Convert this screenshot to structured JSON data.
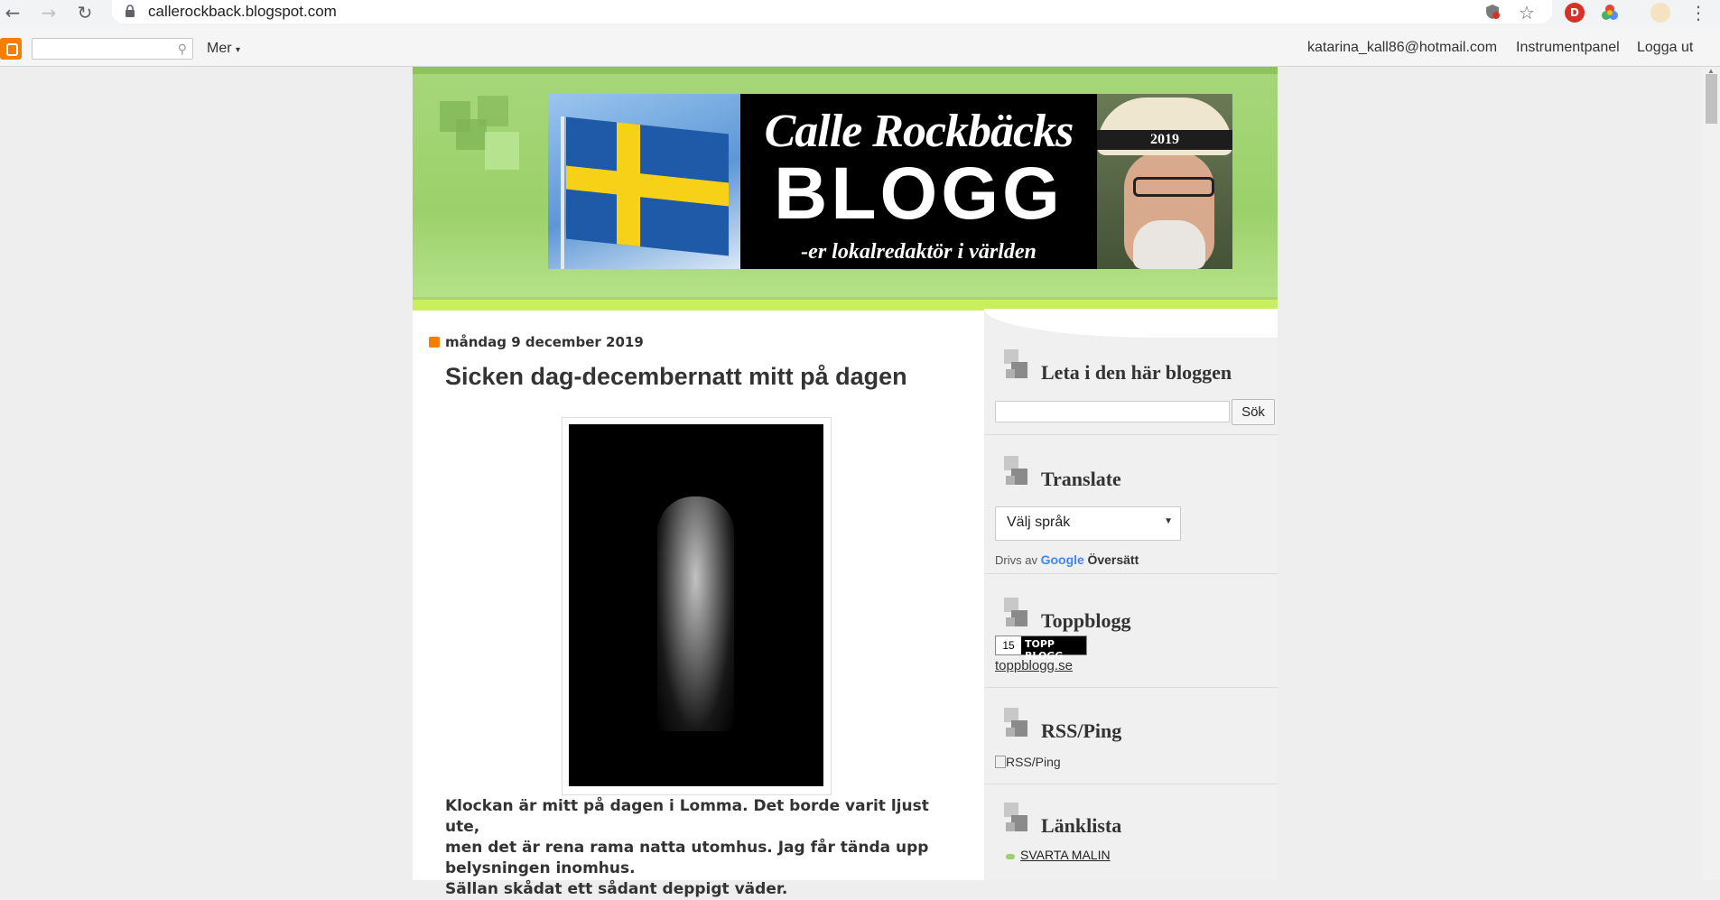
{
  "browser": {
    "url": "callerockback.blogspot.com",
    "back_icon": "←",
    "forward_icon": "→",
    "reload_icon": "↻",
    "star_icon": "☆",
    "menu_icon": "⋮",
    "ext_d_label": "D"
  },
  "navbar": {
    "more_label": "Mer",
    "email": "katarina_kall86@hotmail.com",
    "dashboard_label": "Instrumentpanel",
    "logout_label": "Logga ut"
  },
  "header": {
    "title_line1": "Calle Rockbäcks",
    "title_line2": "BLOGG",
    "title_line3": "-er lokalredaktör i världen",
    "hat_text": "2019"
  },
  "post": {
    "date": "måndag 9 december 2019",
    "title": "Sicken dag-decembernatt mitt på dagen",
    "body_lines": [
      "Klockan är mitt på dagen i Lomma. Det borde varit ljust ute,",
      "men det är rena rama natta utomhus. Jag får tända upp",
      "belysningen inomhus.",
      "Sällan skådat ett sådant deppigt väder."
    ]
  },
  "sidebar": {
    "search": {
      "title": "Leta i den här bloggen",
      "button_label": "Sök",
      "input_value": ""
    },
    "translate": {
      "title": "Translate",
      "select_value": "Välj språk",
      "powered_prefix": "Drivs av",
      "google_label": "Google",
      "translate_label": "Översätt"
    },
    "toppblogg": {
      "title": "Toppblogg",
      "badge_number": "15",
      "badge_text": "TOPP BLOGG",
      "link": "toppblogg.se"
    },
    "rss": {
      "title": "RSS/Ping",
      "image_alt": "RSS/Ping"
    },
    "links": {
      "title": "Länklista",
      "items": [
        "SVARTA MALIN"
      ]
    }
  },
  "colors": {
    "header_green": "#9bd16a",
    "sidebar_bg": "#f0f0f0",
    "page_bg": "#eeeeee",
    "blogger_orange": "#f57d00"
  }
}
